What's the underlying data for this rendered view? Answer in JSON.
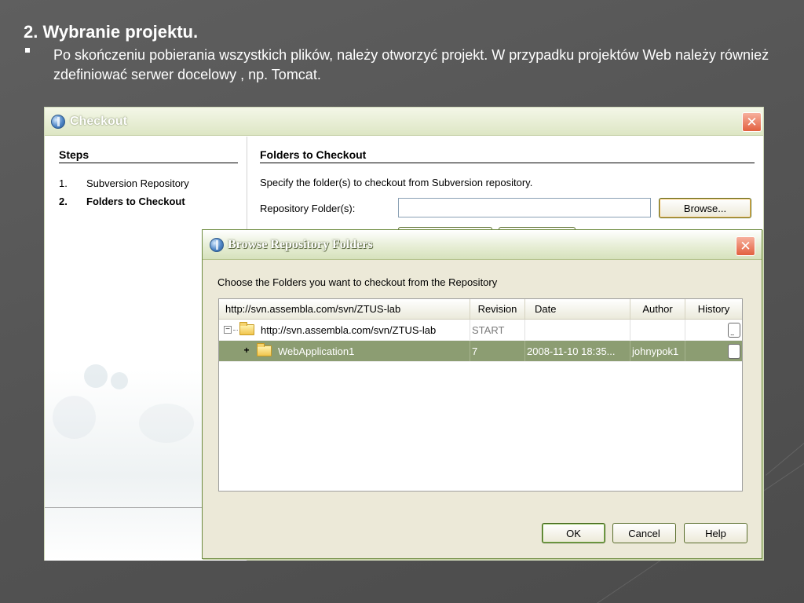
{
  "slide": {
    "title": "2. Wybranie projektu.",
    "bullet": "Po skończeniu pobierania wszystkich plików, należy otworzyć projekt. W przypadku projektów Web należy również zdefiniować serwer docelowy , np. Tomcat."
  },
  "checkout": {
    "title": "Checkout",
    "close_label": "✕",
    "steps_heading": "Steps",
    "steps": [
      {
        "num": "1.",
        "label": "Subversion Repository"
      },
      {
        "num": "2.",
        "label": "Folders to Checkout"
      }
    ],
    "main_heading": "Folders to Checkout",
    "description": "Specify the folder(s) to checkout from Subversion repository.",
    "repo_folder_label": "Repository Folder(s):",
    "repo_folder_value": "",
    "browse_label": "Browse..."
  },
  "dialog": {
    "title": "Browse Repository Folders",
    "close_label": "✕",
    "instruction": "Choose the Folders you want to checkout from the Repository",
    "columns": [
      "http://svn.assembla.com/svn/ZTUS-lab",
      "Revision",
      "Date",
      "Author",
      "History"
    ],
    "rows": [
      {
        "expander": "−",
        "name": "http://svn.assembla.com/svn/ZTUS-lab",
        "revision": "START",
        "date": "",
        "author": "",
        "selected": false
      },
      {
        "expander": "+",
        "name": "WebApplication1",
        "revision": "7",
        "date": "2008-11-10 18:35...",
        "author": "johnypok1",
        "selected": true
      }
    ],
    "ok_label": "OK",
    "cancel_label": "Cancel",
    "help_label": "Help"
  },
  "colors": {
    "slide_background": "#555555",
    "selection": "#8c9d72",
    "titlebar": "#dde6c4",
    "close_button": "#e2603f",
    "dialog_background": "#ece9d8"
  }
}
